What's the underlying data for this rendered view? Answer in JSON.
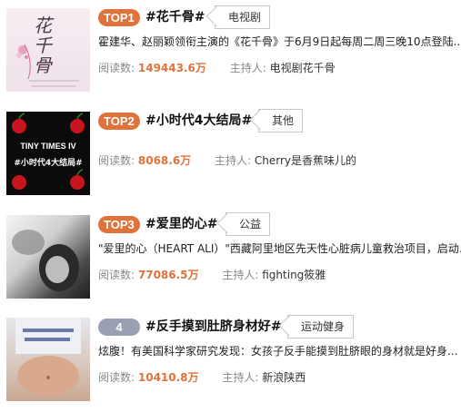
{
  "colors": {
    "rank_top": "#e0723c",
    "rank_other": "#9aa0b4",
    "count": "#e0723c"
  },
  "items": [
    {
      "rank": "TOP1",
      "title": "#花千骨#",
      "tag": "电视剧",
      "desc": "霍建华、赵丽颖领衔主演的《花千骨》于6月9日起每周二周三晚10点登陆...",
      "count_label": "阅读数:",
      "count": "149443.6万",
      "host_label": "主持人:",
      "host": "电视剧花千骨",
      "image": {
        "text": "花千骨"
      }
    },
    {
      "rank": "TOP2",
      "title": "#小时代4大结局#",
      "tag": "其他",
      "desc": "",
      "count_label": "阅读数:",
      "count": "8068.6万",
      "host_label": "主持人:",
      "host": "Cherry是香蕉味儿的",
      "image": {
        "text": "TINY TIMES IV",
        "sub": "#小时代4大结局#"
      }
    },
    {
      "rank": "TOP3",
      "title": "#爱里的心#",
      "tag": "公益",
      "desc": "\"爱里的心（HEART ALI）\"西藏阿里地区先天性心脏病儿童救治项目，启动...",
      "count_label": "阅读数:",
      "count": "77086.5万",
      "host_label": "主持人:",
      "host": "fighting筱雅",
      "image": {}
    },
    {
      "rank": "4",
      "title": "#反手摸到肚脐身材好#",
      "tag": "运动健身",
      "desc": "炫腹！有美国科学家研究发现：女孩子反手能摸到肚脐眼的身材就是好身...",
      "count_label": "阅读数:",
      "count": "10410.8万",
      "host_label": "主持人:",
      "host": "新浪陕西",
      "image": {}
    }
  ]
}
